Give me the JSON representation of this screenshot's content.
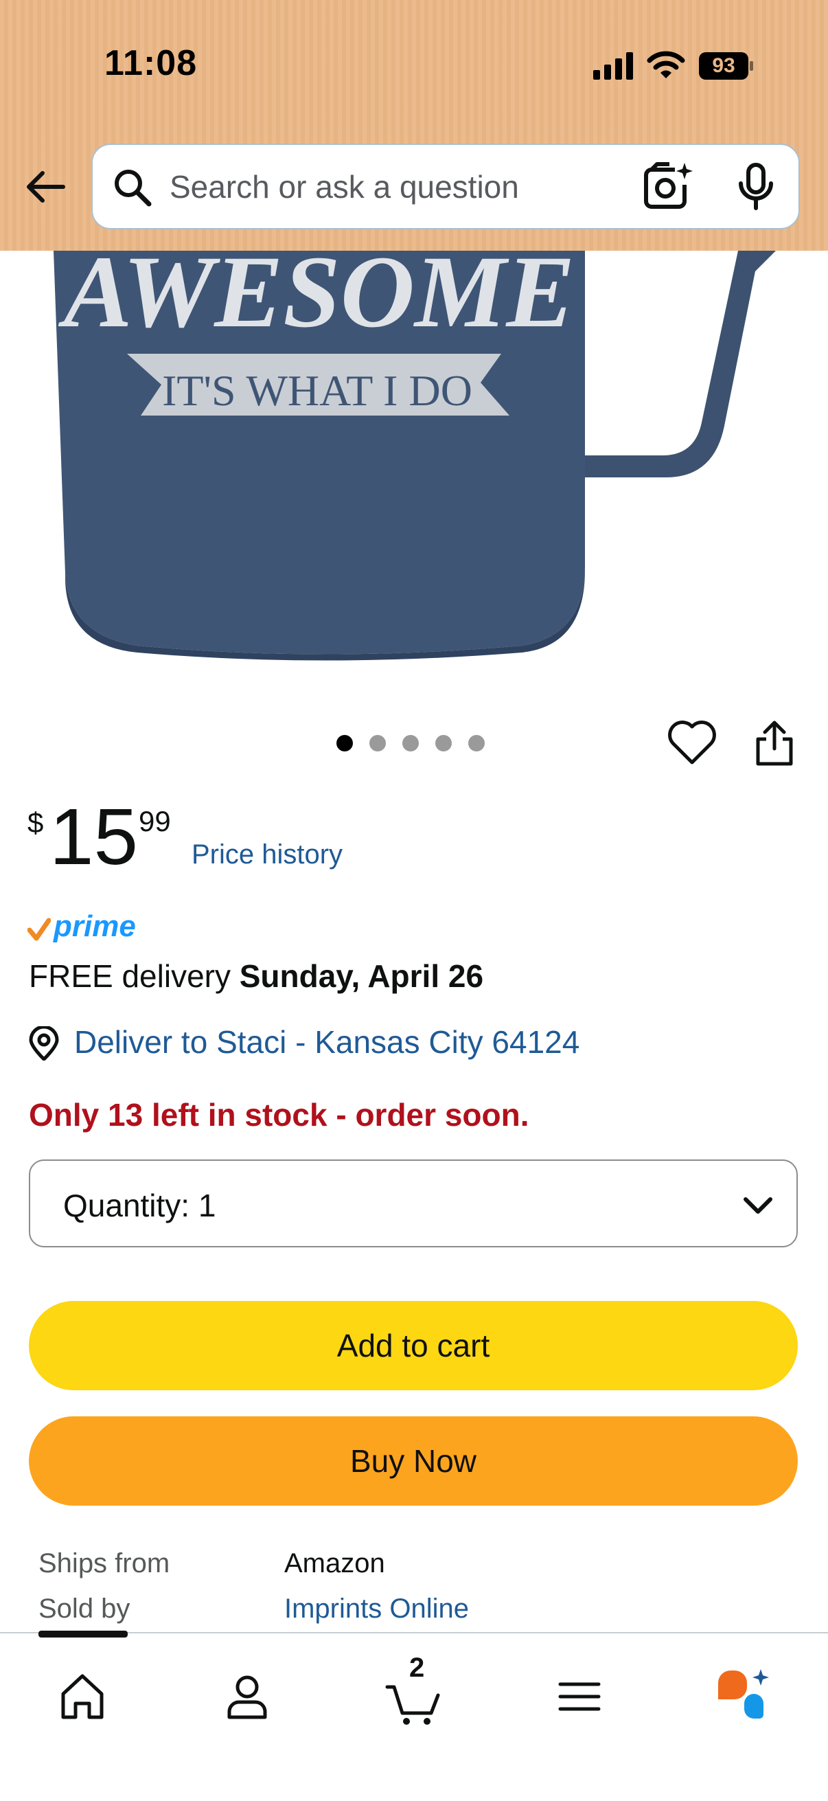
{
  "status_bar": {
    "time": "11:08",
    "battery": "93"
  },
  "search": {
    "placeholder": "Search or ask a question"
  },
  "product_image": {
    "carousel_total": 5,
    "carousel_active": 1,
    "mug_text_main": "AWESOME",
    "mug_text_banner": "IT'S WHAT I DO"
  },
  "price": {
    "symbol": "$",
    "whole": "15",
    "fraction": "99",
    "history_label": "Price history"
  },
  "prime": {
    "label": "prime"
  },
  "delivery": {
    "prefix": "FREE delivery",
    "date": "Sunday, April 26",
    "deliver_to": "Deliver to Staci - Kansas City 64124"
  },
  "stock": {
    "message": "Only 13 left in stock - order soon."
  },
  "quantity": {
    "label": "Quantity:",
    "value": "1"
  },
  "buttons": {
    "add_to_cart": "Add to cart",
    "buy_now": "Buy Now"
  },
  "info": {
    "ships_from_label": "Ships from",
    "ships_from_value": "Amazon",
    "sold_by_label": "Sold by",
    "sold_by_value": "Imprints Online"
  },
  "bottom_nav": {
    "items": [
      "home-icon",
      "account-icon",
      "cart-icon",
      "menu-icon",
      "rufus-icon"
    ],
    "cart_count": "2"
  },
  "colors": {
    "header": "#ebb786",
    "add_to_cart": "#fcd712",
    "buy_now": "#fda41e",
    "link": "#1f5a96",
    "stock_warning": "#b0111c"
  }
}
